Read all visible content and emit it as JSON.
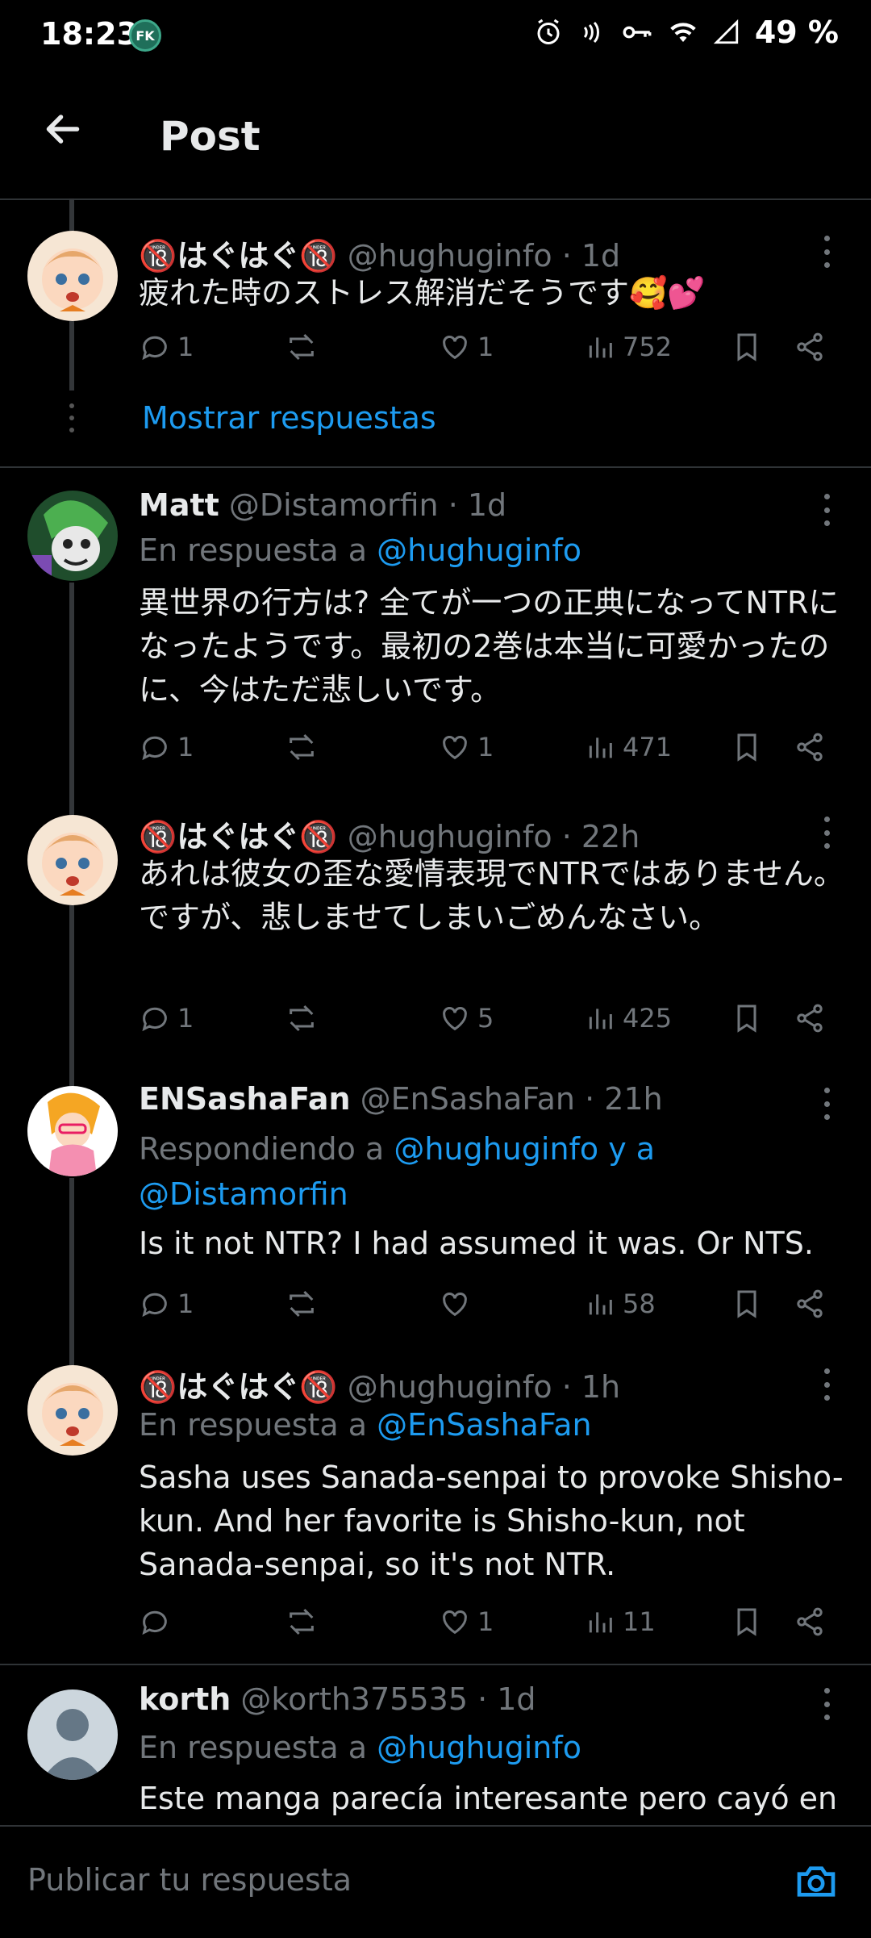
{
  "status_bar": {
    "time": "18:23",
    "badge": "FK",
    "battery": "49 %"
  },
  "header": {
    "title": "Post"
  },
  "show_replies": "Mostrar respuestas",
  "posts": [
    {
      "name": "🔞はぐはぐ🔞",
      "handle": "@hughuginfo",
      "age": "· 1d",
      "reply_prefix": "",
      "reply_targets": "",
      "text": "疲れた時のストレス解消だそうです🥰💕",
      "replies": "1",
      "reposts": "",
      "likes": "1",
      "views": "752"
    },
    {
      "name": "Matt",
      "handle": "@Distamorfin",
      "age": "· 1d",
      "reply_prefix": "En respuesta a",
      "reply_targets": "@hughuginfo",
      "text": "異世界の行方は? 全てが一つの正典になってNTRになったようです。最初の2巻は本当に可愛かったのに、今はただ悲しいです。",
      "replies": "1",
      "reposts": "",
      "likes": "1",
      "views": "471"
    },
    {
      "name": "🔞はぐはぐ🔞",
      "handle": "@hughuginfo",
      "age": "· 22h",
      "reply_prefix": "",
      "reply_targets": "",
      "text": "あれは彼女の歪な愛情表現でNTRではありません。\nですが、悲しませてしまいごめんなさい。",
      "replies": "1",
      "reposts": "",
      "likes": "5",
      "views": "425"
    },
    {
      "name": "ENSashaFan",
      "handle": "@EnSashaFan",
      "age": "· 21h",
      "reply_prefix": "Respondiendo a",
      "reply_targets": "@hughuginfo y a\n@Distamorfin",
      "text": "Is it not NTR? I had assumed it was. Or NTS.",
      "replies": "1",
      "reposts": "",
      "likes": "",
      "views": "58"
    },
    {
      "name": "🔞はぐはぐ🔞",
      "handle": "@hughuginfo",
      "age": "· 1h",
      "reply_prefix": "En respuesta a",
      "reply_targets": "@EnSashaFan",
      "text": "Sasha uses Sanada-senpai to provoke Shisho-kun. And her favorite is Shisho-kun, not Sanada-senpai, so it's not NTR.",
      "replies": "",
      "reposts": "",
      "likes": "1",
      "views": "11"
    },
    {
      "name": "korth",
      "handle": "@korth375535",
      "age": "· 1d",
      "reply_prefix": "En respuesta a",
      "reply_targets": "@hughuginfo",
      "text": "Este manga parecía interesante pero cayó en"
    }
  ],
  "reply_bar": {
    "placeholder": "Publicar tu respuesta"
  }
}
